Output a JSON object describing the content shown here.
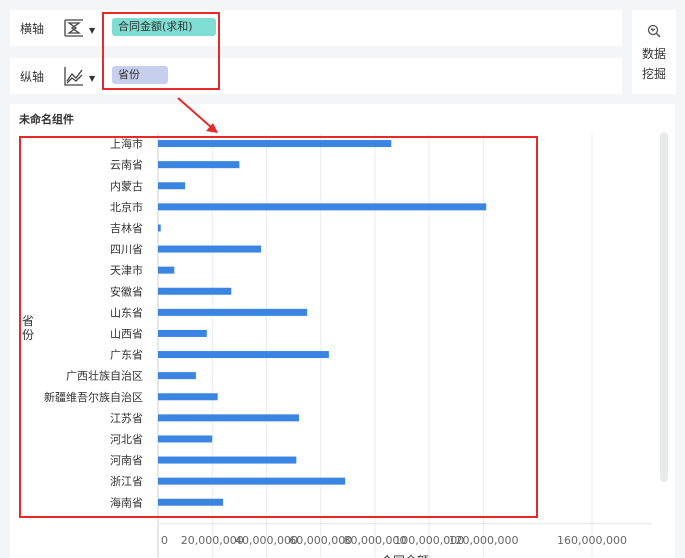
{
  "shelf": {
    "x_axis": {
      "label": "横轴",
      "field": "合同金额(求和)",
      "icon": "bar-chart-icon"
    },
    "y_axis": {
      "label": "纵轴",
      "field": "省份",
      "icon": "line-chart-icon"
    }
  },
  "data_mining": {
    "line1": "数据",
    "line2": "挖掘",
    "icon": "data-mining-icon"
  },
  "component": {
    "title": "未命名组件"
  },
  "colors": {
    "bar": "#3b85e2",
    "highlight": "#e62a2a",
    "x_pill": "#7fddd3",
    "y_pill": "#c6cfee"
  },
  "chart_data": {
    "type": "bar",
    "orientation": "horizontal",
    "categories": [
      "上海市",
      "云南省",
      "内蒙古",
      "北京市",
      "吉林省",
      "四川省",
      "天津市",
      "安徽省",
      "山东省",
      "山西省",
      "广东省",
      "广西壮族自治区",
      "新疆维吾尔族自治区",
      "江苏省",
      "河北省",
      "河南省",
      "浙江省",
      "海南省"
    ],
    "values": [
      86000000,
      30000000,
      10000000,
      121000000,
      1000000,
      38000000,
      6000000,
      27000000,
      55000000,
      18000000,
      63000000,
      14000000,
      22000000,
      52000000,
      20000000,
      51000000,
      69000000,
      24000000
    ],
    "xlabel": "合同金额",
    "ylabel": "省份",
    "xlim": [
      0,
      160000000
    ],
    "xticks": [
      "0",
      "20,000,000",
      "40,000,000",
      "60,000,000",
      "80,000,000",
      "100,000,000",
      "120,000,000",
      "160,000,000"
    ],
    "xtick_values": [
      0,
      20000000,
      40000000,
      60000000,
      80000000,
      100000000,
      120000000,
      160000000
    ],
    "grid": true
  }
}
